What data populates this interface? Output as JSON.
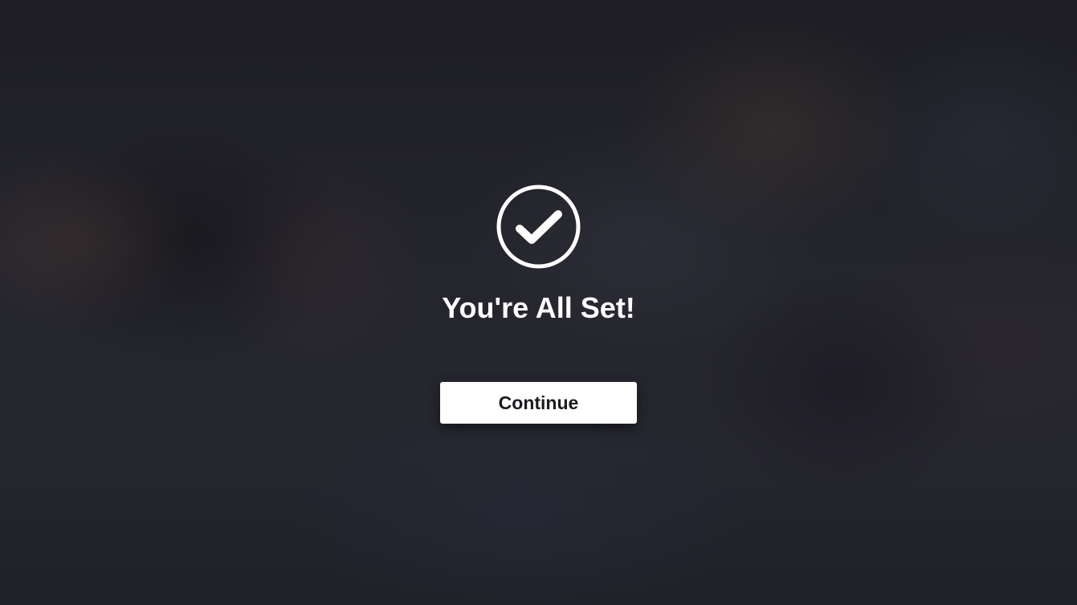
{
  "confirmation": {
    "icon": "checkmark-circle-icon",
    "title": "You're All Set!",
    "continue_label": "Continue"
  },
  "colors": {
    "background": "#1f1f26",
    "text": "#ffffff",
    "button_background": "#ffffff",
    "button_text": "#1b1b1f"
  }
}
